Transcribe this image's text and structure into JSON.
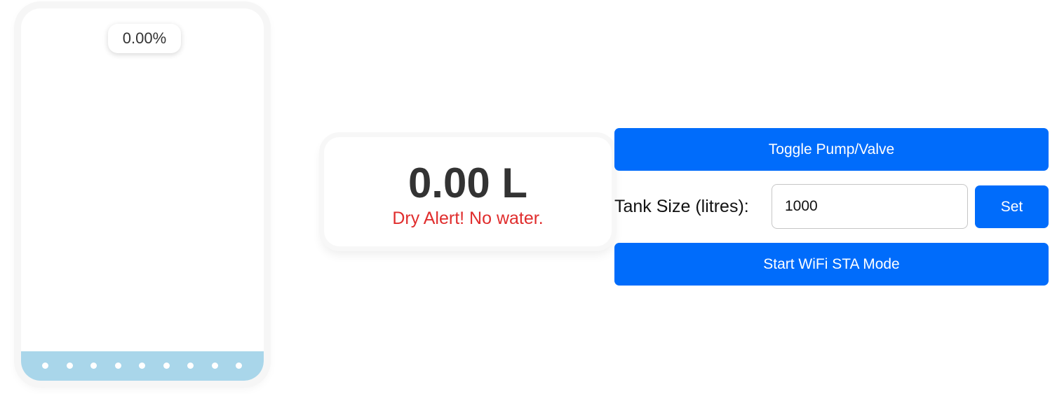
{
  "tank": {
    "percent_label": "0.00%",
    "fill_fraction": 0.0
  },
  "volume": {
    "value_label": "0.00 L",
    "alert_text": "Dry Alert! No water."
  },
  "controls": {
    "toggle_label": "Toggle Pump/Valve",
    "tank_size_label": "Tank Size (litres):",
    "tank_size_value": "1000",
    "set_label": "Set",
    "wifi_label": "Start WiFi STA Mode"
  },
  "colors": {
    "accent": "#006cfb",
    "water": "#a9d6ea",
    "alert": "#e02d2d"
  }
}
